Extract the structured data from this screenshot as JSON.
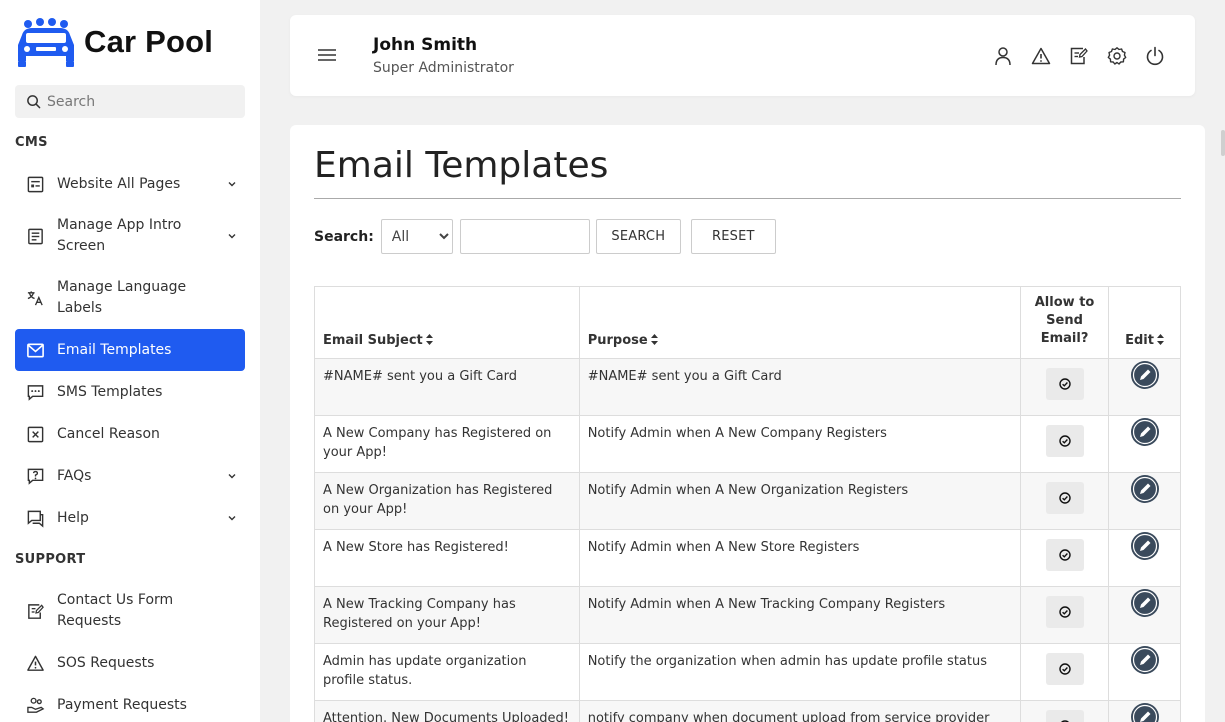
{
  "brand": {
    "name": "Car Pool"
  },
  "sidebar": {
    "search_placeholder": "Search",
    "sections": {
      "cms": "CMS",
      "support": "SUPPORT"
    },
    "items": [
      {
        "label": "Website All Pages",
        "icon": "page-icon"
      },
      {
        "label": "Manage App Intro Screen",
        "icon": "intro-screen-icon"
      },
      {
        "label": "Manage Language Labels",
        "icon": "translate-icon"
      },
      {
        "label": "Email Templates",
        "icon": "mail-icon"
      },
      {
        "label": "SMS Templates",
        "icon": "sms-icon"
      },
      {
        "label": "Cancel Reason",
        "icon": "cancel-icon"
      },
      {
        "label": "FAQs",
        "icon": "faq-icon"
      },
      {
        "label": "Help",
        "icon": "help-icon"
      },
      {
        "label": "Contact Us Form Requests",
        "icon": "contact-form-icon"
      },
      {
        "label": "SOS Requests",
        "icon": "warning-icon"
      },
      {
        "label": "Payment Requests",
        "icon": "payment-icon"
      }
    ]
  },
  "header": {
    "user_name": "John Smith",
    "user_role": "Super Administrator"
  },
  "main": {
    "title": "Email Templates",
    "search_label": "Search:",
    "filter_selected": "All",
    "search_button": "SEARCH",
    "reset_button": "RESET",
    "columns": [
      "Email Subject",
      "Purpose",
      "Allow to Send Email?",
      "Edit"
    ],
    "rows": [
      {
        "subject": "#NAME# sent you a Gift Card",
        "purpose": "#NAME# sent you a Gift Card"
      },
      {
        "subject": "A New Company has Registered on your App!",
        "purpose": "Notify Admin when A New Company Registers"
      },
      {
        "subject": "A New Organization has Registered on your App!",
        "purpose": "Notify Admin when A New Organization Registers"
      },
      {
        "subject": "A New Store has Registered!",
        "purpose": "Notify Admin when A New Store Registers"
      },
      {
        "subject": "A New Tracking Company has Registered on your App!",
        "purpose": "Notify Admin when A New Tracking Company Registers"
      },
      {
        "subject": "Admin has update organization profile status.",
        "purpose": "Notify the organization when admin has update profile status"
      },
      {
        "subject": "Attention. New Documents Uploaded!",
        "purpose": "notify company when document upload from service provider side for profile and vehicle"
      }
    ]
  },
  "colors": {
    "accent": "#1f5bf0",
    "edit_icon": "#3a4a5c"
  }
}
